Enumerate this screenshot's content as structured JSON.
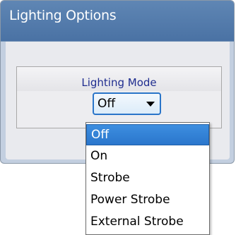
{
  "panel": {
    "title": "Lighting Options"
  },
  "group": {
    "label": "Lighting Mode"
  },
  "combo": {
    "selected_value": "Off"
  },
  "dropdown": {
    "items": [
      {
        "label": "Off",
        "selected": true
      },
      {
        "label": "On",
        "selected": false
      },
      {
        "label": "Strobe",
        "selected": false
      },
      {
        "label": "Power Strobe",
        "selected": false
      },
      {
        "label": "External Strobe",
        "selected": false
      }
    ]
  },
  "colors": {
    "header": "#4a72a4",
    "selection": "#2a76cc",
    "group_label": "#1f2d8f"
  }
}
